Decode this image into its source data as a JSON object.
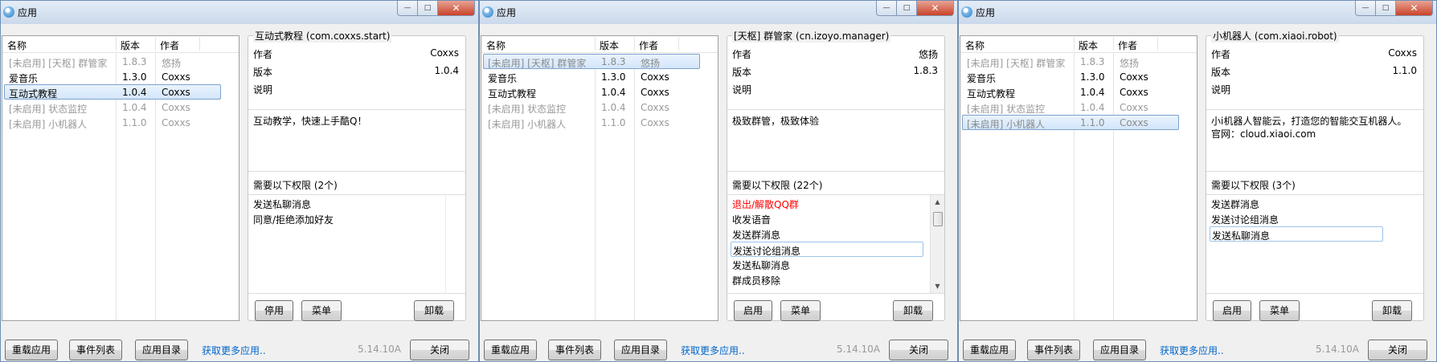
{
  "common": {
    "title": "应用",
    "col_name": "名称",
    "col_version": "版本",
    "col_author": "作者",
    "author_label": "作者",
    "version_label": "版本",
    "desc_label": "说明",
    "btn_reload": "重载应用",
    "btn_events": "事件列表",
    "btn_appdir": "应用目录",
    "link_more": "获取更多应用..",
    "app_version": "5.14.10A",
    "btn_close": "关闭",
    "btn_menu": "菜单",
    "btn_uninstall": "卸载",
    "win_min": "—",
    "win_max": "□",
    "win_close": "✕",
    "scroll_up": "▲",
    "scroll_down": "▼"
  },
  "windows": [
    {
      "apps": [
        {
          "name": "[未启用] [天枢] 群管家",
          "version": "1.8.3",
          "author": "悠扬"
        },
        {
          "name": "爱音乐",
          "version": "1.3.0",
          "author": "Coxxs"
        },
        {
          "name": "互动式教程",
          "version": "1.0.4",
          "author": "Coxxs"
        },
        {
          "name": "[未启用] 状态监控",
          "version": "1.0.4",
          "author": "Coxxs"
        },
        {
          "name": "[未启用] 小机器人",
          "version": "1.1.0",
          "author": "Coxxs"
        }
      ],
      "detail_title": "互动式教程 (com.coxxs.start)",
      "author": "Coxxs",
      "version": "1.0.4",
      "desc_line1": "互动教学，快速上手酷Q！",
      "desc_line2": "",
      "perm_title": "需要以下权限 (2个)",
      "perms": [
        "发送私聊消息",
        "同意/拒绝添加好友"
      ],
      "toggle_label": "停用"
    },
    {
      "apps": [
        {
          "name": "[未启用] [天枢] 群管家",
          "version": "1.8.3",
          "author": "悠扬"
        },
        {
          "name": "爱音乐",
          "version": "1.3.0",
          "author": "Coxxs"
        },
        {
          "name": "互动式教程",
          "version": "1.0.4",
          "author": "Coxxs"
        },
        {
          "name": "[未启用] 状态监控",
          "version": "1.0.4",
          "author": "Coxxs"
        },
        {
          "name": "[未启用] 小机器人",
          "version": "1.1.0",
          "author": "Coxxs"
        }
      ],
      "detail_title": "[天枢] 群管家 (cn.izoyo.manager)",
      "author": "悠扬",
      "version": "1.8.3",
      "desc_line1": "极致群管，极致体验",
      "desc_line2": "",
      "perm_title": "需要以下权限 (22个)",
      "perms": [
        "退出/解散QQ群",
        "收发语音",
        "发送群消息",
        "发送讨论组消息",
        "发送私聊消息",
        "群成员移除"
      ],
      "toggle_label": "启用"
    },
    {
      "apps": [
        {
          "name": "[未启用] [天枢] 群管家",
          "version": "1.8.3",
          "author": "悠扬"
        },
        {
          "name": "爱音乐",
          "version": "1.3.0",
          "author": "Coxxs"
        },
        {
          "name": "互动式教程",
          "version": "1.0.4",
          "author": "Coxxs"
        },
        {
          "name": "[未启用] 状态监控",
          "version": "1.0.4",
          "author": "Coxxs"
        },
        {
          "name": "[未启用] 小机器人",
          "version": "1.1.0",
          "author": "Coxxs"
        }
      ],
      "detail_title": "小机器人 (com.xiaoi.robot)",
      "author": "Coxxs",
      "version": "1.1.0",
      "desc_line1": "小i机器人智能云，打造您的智能交互机器人。",
      "desc_line2": "官网：cloud.xiaoi.com",
      "perm_title": "需要以下权限 (3个)",
      "perms": [
        "发送群消息",
        "发送讨论组消息",
        "发送私聊消息"
      ],
      "toggle_label": "启用"
    }
  ]
}
